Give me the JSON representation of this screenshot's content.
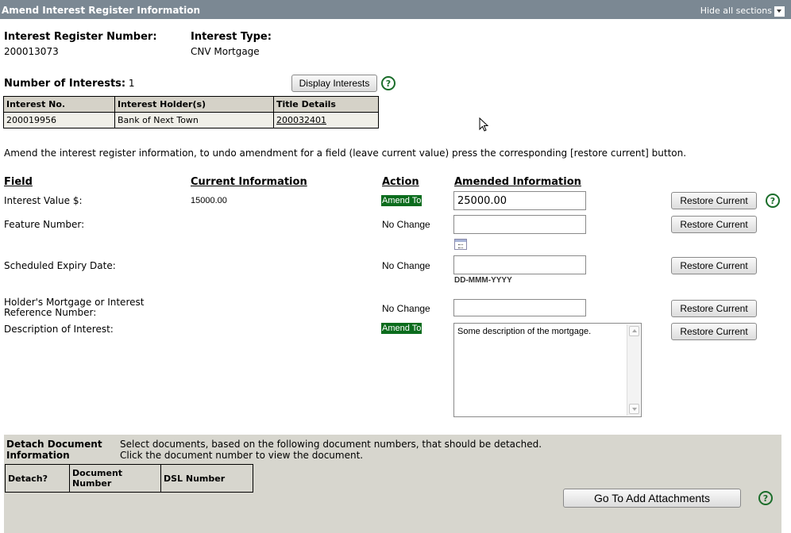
{
  "section": {
    "title": "Amend Interest Register Information",
    "hide_all": "Hide all sections"
  },
  "register": {
    "number_label": "Interest Register Number:",
    "number_value": "200013073",
    "type_label": "Interest Type:",
    "type_value": "CNV Mortgage"
  },
  "interests": {
    "count_label": "Number of Interests:",
    "count_value": "1",
    "display_button": "Display Interests",
    "help": "?",
    "columns": [
      "Interest No.",
      "Interest Holder(s)",
      "Title Details"
    ],
    "rows": [
      {
        "no": "200019956",
        "holder": "Bank of Next Town",
        "title": "200032401"
      }
    ]
  },
  "instructions": "Amend the interest register information, to undo amendment for a field (leave current value) press the corresponding [restore current] button.",
  "amend_table": {
    "headers": {
      "field": "Field",
      "current": "Current Information",
      "action": "Action",
      "amended": "Amended Information"
    },
    "restore_label": "Restore Current",
    "help": "?",
    "rows": [
      {
        "field": "Interest Value $:",
        "current": "15000.00",
        "action": "Amend To",
        "amended": "25000.00"
      },
      {
        "field": "Feature Number:",
        "current": "",
        "action": "No Change",
        "amended": ""
      },
      {
        "field": "Scheduled Expiry Date:",
        "current": "",
        "action": "No Change",
        "amended": "",
        "hint": "DD-MMM-YYYY"
      },
      {
        "field": "Holder's Mortgage or Interest",
        "field_line2": "Reference Number:",
        "current": "",
        "action": "No Change",
        "amended": ""
      },
      {
        "field": "Description of Interest:",
        "current": "",
        "action": "Amend To",
        "amended": "Some description of the mortgage."
      }
    ]
  },
  "detach": {
    "title_line1": "Detach Document",
    "title_line2": "Information",
    "desc_line1": "Select documents, based on the following document numbers, that should be detached.",
    "desc_line2": "Click the document number to view the document.",
    "columns": [
      "Detach?",
      "Document Number",
      "DSL Number"
    ],
    "add_attachments_button": "Go To Add Attachments",
    "help": "?"
  },
  "colors": {
    "section_bar": "#7b8893",
    "amend_badge": "#0b6c1d",
    "help": "#1a6d2a",
    "detach_panel": "#d7d6ce"
  }
}
